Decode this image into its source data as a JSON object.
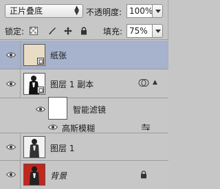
{
  "options": {
    "blend_mode": "正片叠底",
    "opacity_label": "不透明度:",
    "opacity_value": "100%",
    "lock_label": "锁定:",
    "fill_label": "填充:",
    "fill_value": "75%"
  },
  "icons": {
    "lock_transparent": "checkerboard-icon",
    "lock_image": "brush-icon",
    "lock_position": "move-icon",
    "lock_all": "padlock-icon",
    "eye": "eye-icon",
    "smart_object": "smart-object-badge-icon",
    "filter_options": "filter-options-icon",
    "smart_filter_indicator": "smart-filter-circles-icon",
    "background_lock": "padlock-icon"
  },
  "layers": [
    {
      "name": "纸张",
      "selected": true
    },
    {
      "name": "图层 1 副本",
      "selected": false
    },
    {
      "name": "智能滤镜",
      "selected": false
    },
    {
      "name": "高斯模糊",
      "selected": false
    },
    {
      "name": "图层 1",
      "selected": false
    },
    {
      "name": "背景",
      "selected": false
    }
  ],
  "colors": {
    "panel_bg": "#c7c7c7",
    "selected_bg": "#a7b2cc",
    "paper_thumb": "#e9dcc4"
  }
}
